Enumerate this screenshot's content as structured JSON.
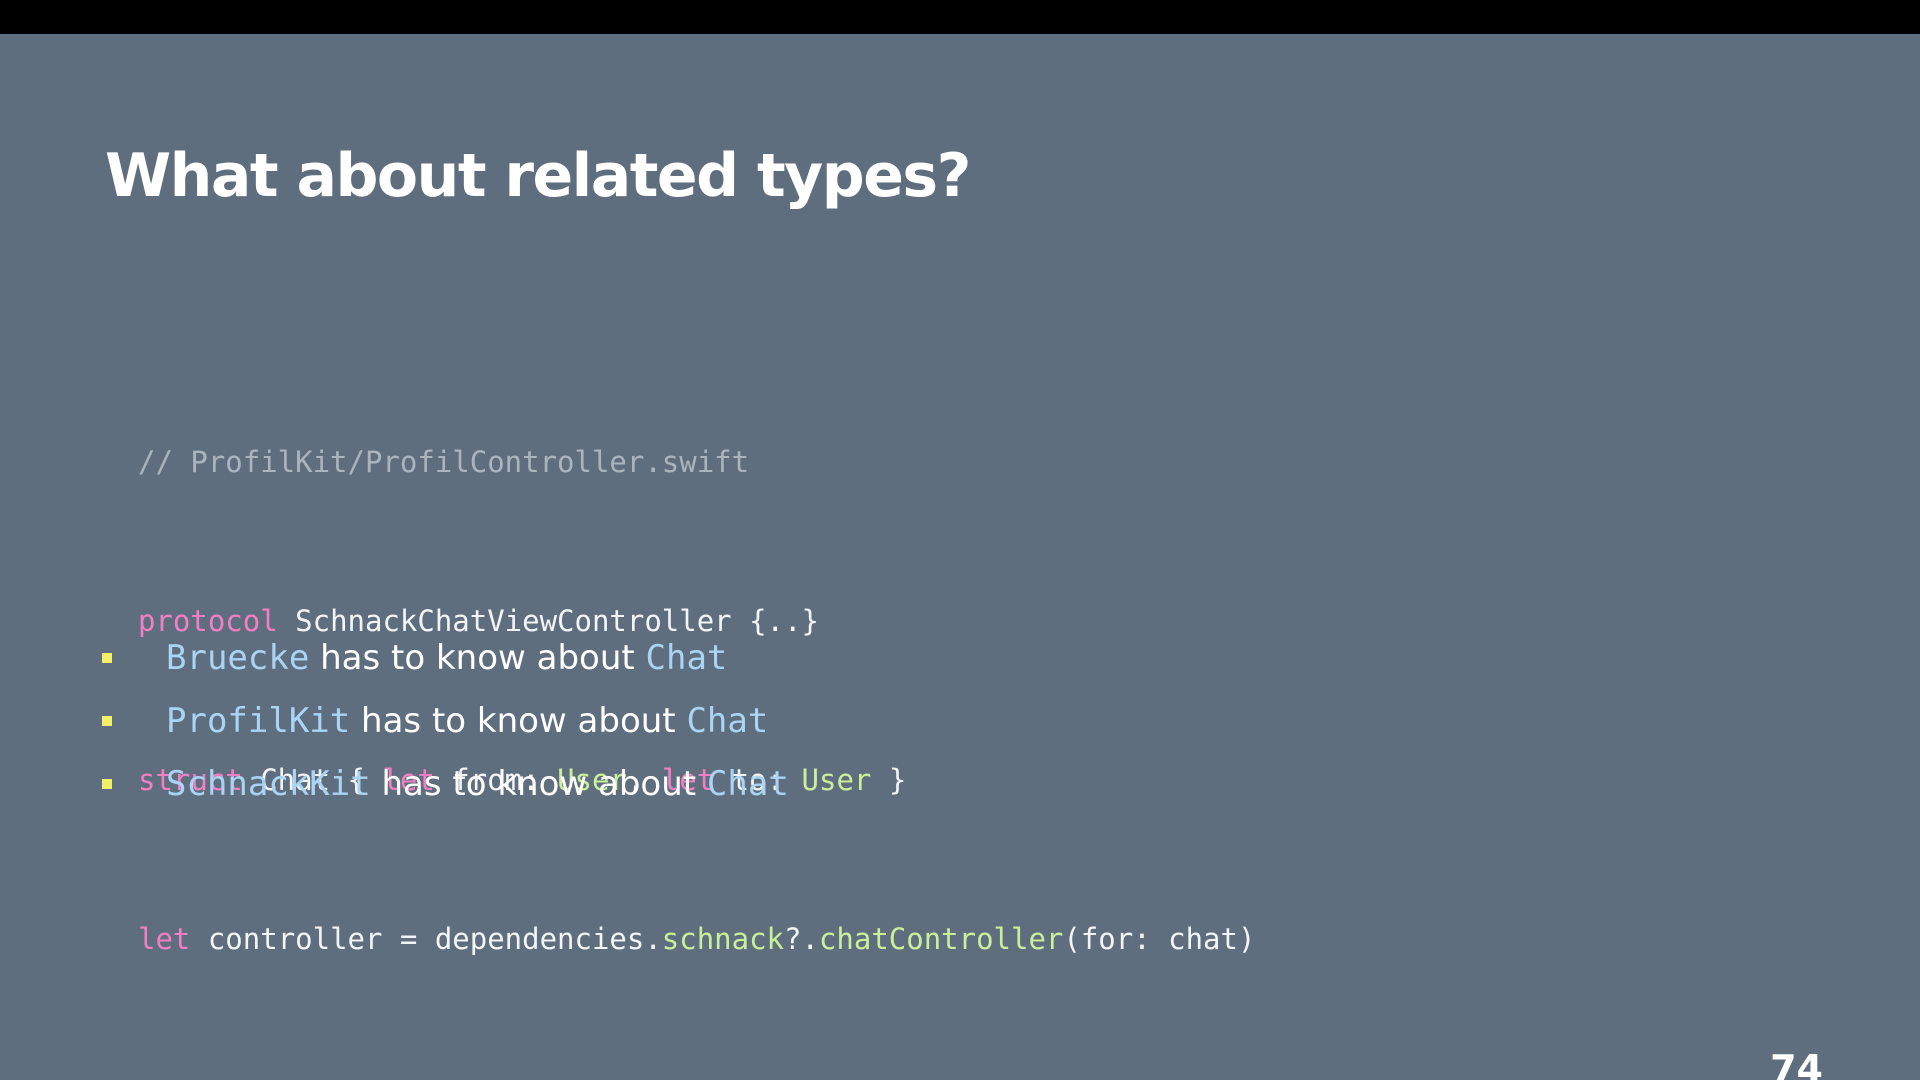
{
  "slide": {
    "title": "What about related types?",
    "page_number": "74"
  },
  "code": {
    "line1": {
      "comment": "// ProfilKit/ProfilController.swift"
    },
    "line2": {
      "kw": "protocol",
      "rest": " SchnackChatViewController {..}"
    },
    "line3": {
      "kw1": "struct",
      "t1": " Chat { ",
      "kw2": "let",
      "t2": " from: ",
      "type1": "User",
      "t3": ", ",
      "kw3": "let",
      "t4": " to: ",
      "type2": "User",
      "t5": " }"
    },
    "line4": {
      "kw": "let",
      "t1": " controller = dependencies.",
      "call1": "schnack",
      "t2": "?.",
      "call2": "chatController",
      "t3": "(for: chat)"
    }
  },
  "bullets": [
    {
      "subject": "Bruecke",
      "text": " has to know about ",
      "object": "Chat"
    },
    {
      "subject": "ProfilKit",
      "text": " has to know about ",
      "object": "Chat"
    },
    {
      "subject": "SchnackKit",
      "text": " has to know about ",
      "object": "Chat"
    }
  ],
  "colors": {
    "background": "#5f6e7e",
    "keyword": "#f07fc4",
    "type": "#c9ef9a",
    "comment": "#aab4bf",
    "inline_code": "#a9d4f4",
    "bullet": "#f4ef6a"
  }
}
